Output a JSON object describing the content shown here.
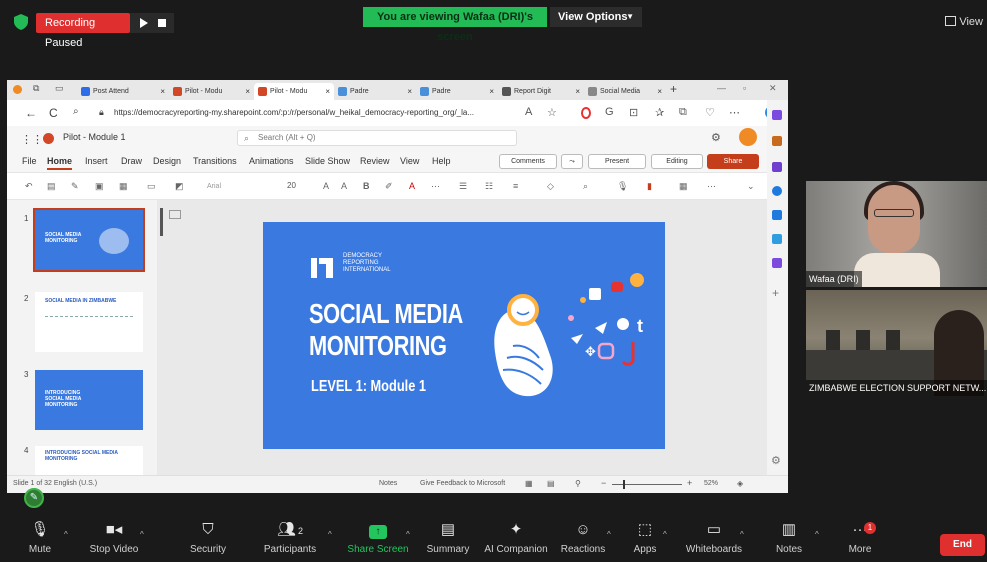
{
  "zoom": {
    "recording_label": "Recording Paused",
    "viewing_banner": "You are viewing Wafaa (DRI)'s screen",
    "view_options": "View Options",
    "view_label": "View",
    "toolbar": [
      {
        "id": "mute",
        "label": "Mute",
        "icon": "microphone-icon"
      },
      {
        "id": "video",
        "label": "Stop Video",
        "icon": "video-camera-icon"
      },
      {
        "id": "security",
        "label": "Security",
        "icon": "shield-icon"
      },
      {
        "id": "participants",
        "label": "Participants",
        "icon": "people-icon",
        "count": "2"
      },
      {
        "id": "share",
        "label": "Share Screen",
        "icon": "share-screen-icon"
      },
      {
        "id": "summary",
        "label": "Summary",
        "icon": "document-icon"
      },
      {
        "id": "ai",
        "label": "AI Companion",
        "icon": "sparkle-icon"
      },
      {
        "id": "reactions",
        "label": "Reactions",
        "icon": "emoji-icon"
      },
      {
        "id": "apps",
        "label": "Apps",
        "icon": "apps-icon"
      },
      {
        "id": "whiteboards",
        "label": "Whiteboards",
        "icon": "whiteboard-icon"
      },
      {
        "id": "notes",
        "label": "Notes",
        "icon": "notes-icon"
      },
      {
        "id": "more",
        "label": "More",
        "icon": "more-icon",
        "badge": "1"
      }
    ],
    "end_label": "End",
    "participants": [
      {
        "name": "Wafaa (DRI)"
      },
      {
        "name": "ZIMBABWE ELECTION SUPPORT NETW..."
      }
    ]
  },
  "browser": {
    "tabs": [
      {
        "label": "Post Attend",
        "color": "#2d6ee8"
      },
      {
        "label": "Pilot - Modu",
        "color": "#d24726"
      },
      {
        "label": "Pilot - Modu",
        "color": "#d24726"
      },
      {
        "label": "Padre",
        "color": "#4a90d9"
      },
      {
        "label": "Padre",
        "color": "#4a90d9"
      },
      {
        "label": "Report Digit",
        "color": "#555555"
      },
      {
        "label": "Social Media",
        "color": "#888888"
      }
    ],
    "url": "https://democracyreporting-my.sharepoint.com/:p:/r/personal/w_heikal_democracy-reporting_org/_la..."
  },
  "ppt": {
    "doc_title": "Pilot - Module 1",
    "search_placeholder": "Search (Alt + Q)",
    "menu": [
      "File",
      "Home",
      "Insert",
      "Draw",
      "Design",
      "Transitions",
      "Animations",
      "Slide Show",
      "Review",
      "View",
      "Help"
    ],
    "active_menu": "Home",
    "comments": "Comments",
    "present": "Present",
    "editing": "Editing",
    "share": "Share",
    "font_name": "Arial",
    "font_size": "20",
    "slide": {
      "org_line1": "DEMOCRACY",
      "org_line2": "REPORTING",
      "org_line3": "INTERNATIONAL",
      "title_line1": "SOCIAL MEDIA",
      "title_line2": "MONITORING",
      "subtitle": "LEVEL 1: Module 1"
    },
    "thumbs": [
      {
        "num": "1",
        "title": "SOCIAL MEDIA MONITORING"
      },
      {
        "num": "2",
        "title": "SOCIAL MEDIA IN ZIMBABWE"
      },
      {
        "num": "3",
        "title": "INTRODUCING SOCIAL MEDIA MONITORING"
      },
      {
        "num": "4",
        "title": "INTRODUCING SOCIAL MEDIA MONITORING"
      }
    ],
    "status_left": "Slide 1 of 32  English (U.S.)",
    "status_notes": "Notes",
    "status_feedback": "Give Feedback to Microsoft",
    "zoom_level": "52%",
    "zoom_fraction": 0.15
  }
}
